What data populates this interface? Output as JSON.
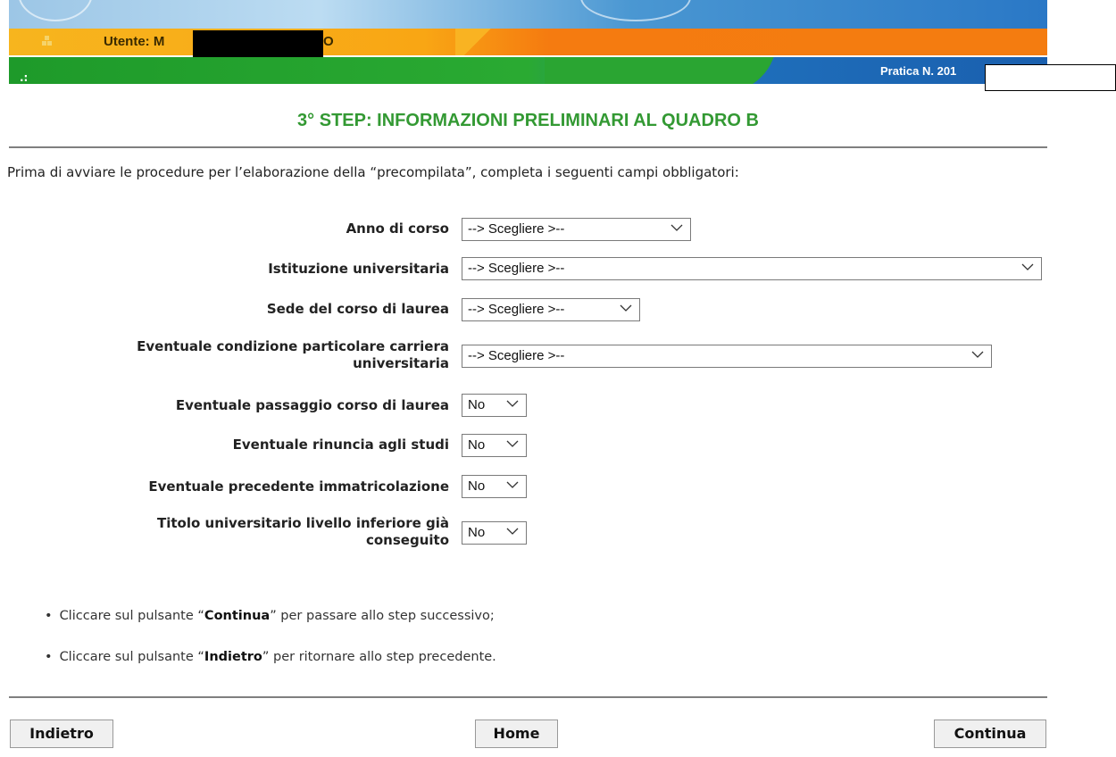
{
  "header": {
    "user_label": "Utente: M",
    "user_name_tail": "O",
    "green_dots": ".:",
    "pratica_label": "Pratica N. 201"
  },
  "title": "3° STEP: INFORMAZIONI PRELIMINARI AL QUADRO B",
  "intro": "Prima di avviare le procedure per l’elaborazione della “precompilata”, completa i seguenti campi obbligatori:",
  "form": {
    "fields": [
      {
        "label": "Anno di corso",
        "value": "--> Scegliere >--"
      },
      {
        "label": "Istituzione universitaria",
        "value": "--> Scegliere >--"
      },
      {
        "label": "Sede del corso di laurea",
        "value": "--> Scegliere >--"
      },
      {
        "label_line1": "Eventuale condizione particolare carriera",
        "label_line2": "universitaria",
        "value": "--> Scegliere >--"
      },
      {
        "label": "Eventuale passaggio corso di laurea",
        "value": "No"
      },
      {
        "label": "Eventuale rinuncia agli studi",
        "value": "No"
      },
      {
        "label": "Eventuale precedente immatricolazione",
        "value": "No"
      },
      {
        "label_line1": "Titolo universitario livello inferiore già",
        "label_line2": "conseguito",
        "value": "No"
      }
    ]
  },
  "instructions": [
    {
      "pre": "Cliccare sul pulsante “",
      "bold": "Continua",
      "post": "” per passare allo step successivo;"
    },
    {
      "pre": "Cliccare sul pulsante “",
      "bold": "Indietro",
      "post": "” per ritornare allo step precedente."
    }
  ],
  "buttons": {
    "back": "Indietro",
    "home": "Home",
    "next": "Continua"
  },
  "colors": {
    "title_green": "#339933",
    "orange_bar": "#f57b10",
    "green_bar": "#2aaa32",
    "blue_bar": "#2a78c6"
  }
}
